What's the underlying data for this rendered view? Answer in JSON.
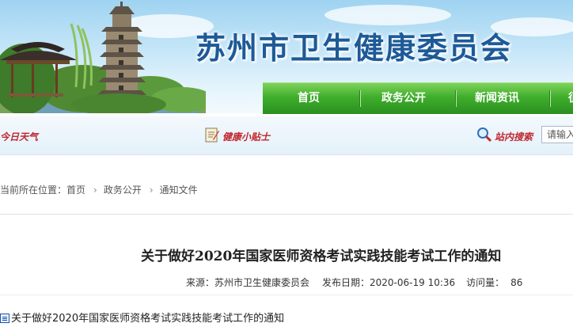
{
  "site": {
    "title": "苏州市卫生健康委员会"
  },
  "nav": {
    "items": [
      "首页",
      "政务公开",
      "新闻资讯",
      "征"
    ]
  },
  "infobar": {
    "weather": "今日天气",
    "tips": "健康小贴士",
    "search_label": "站内搜索",
    "search_placeholder": "请输入"
  },
  "breadcrumb": {
    "prefix": "当前所在位置：",
    "items": [
      "首页",
      "政务公开",
      "通知文件"
    ]
  },
  "article": {
    "title": "关于做好2020年国家医师资格考试实践技能考试工作的通知",
    "source": "来源：苏州市卫生健康委员会",
    "date": "发布日期：2020-06-19 10:36",
    "views_label": "访问量：",
    "views": "86",
    "attachment": "关于做好2020年国家医师资格考试实践技能考试工作的通知"
  },
  "colors": {
    "nav_green": "#3fae2c",
    "title_blue": "#1d5a98",
    "accent_red": "#c0272d"
  }
}
